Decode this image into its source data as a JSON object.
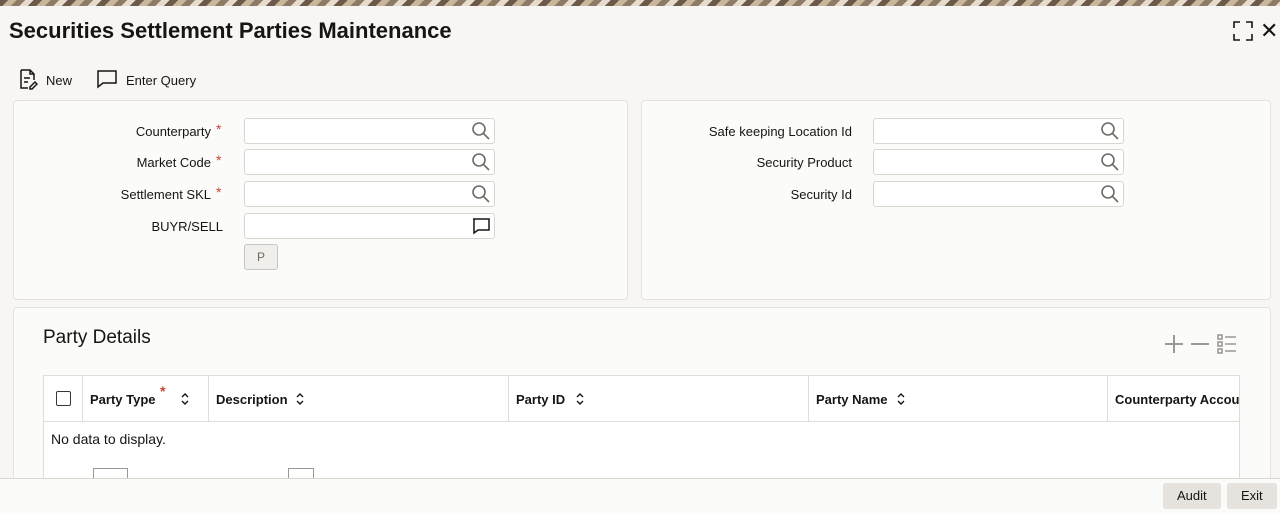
{
  "window": {
    "title": "Securities Settlement Parties Maintenance",
    "maximize_icon": "maximize-icon",
    "close_glyph": "✕"
  },
  "toolbar": {
    "new_label": "New",
    "enter_query_label": "Enter Query"
  },
  "left_form": {
    "counterparty_label": "Counterparty",
    "counterparty_value": "",
    "market_code_label": "Market Code",
    "market_code_value": "",
    "settlement_skl_label": "Settlement SKL",
    "settlement_skl_value": "",
    "buyr_sell_label": "BUYR/SELL",
    "buyr_sell_value": "",
    "p_button_label": "P",
    "required_mark": "*"
  },
  "right_form": {
    "safe_keeping_label": "Safe keeping Location Id",
    "safe_keeping_value": "",
    "security_product_label": "Security Product",
    "security_product_value": "",
    "security_id_label": "Security Id",
    "security_id_value": ""
  },
  "party_details": {
    "title": "Party Details",
    "columns": [
      "Party Type",
      "Description",
      "Party ID",
      "Party Name",
      "Counterparty Account"
    ],
    "required_mark": "*",
    "empty_message": "No data to display."
  },
  "footer": {
    "audit_label": "Audit",
    "exit_label": "Exit"
  },
  "colors": {
    "accent_required": "#c74634",
    "text": "#161513",
    "muted": "#6f6a64"
  }
}
